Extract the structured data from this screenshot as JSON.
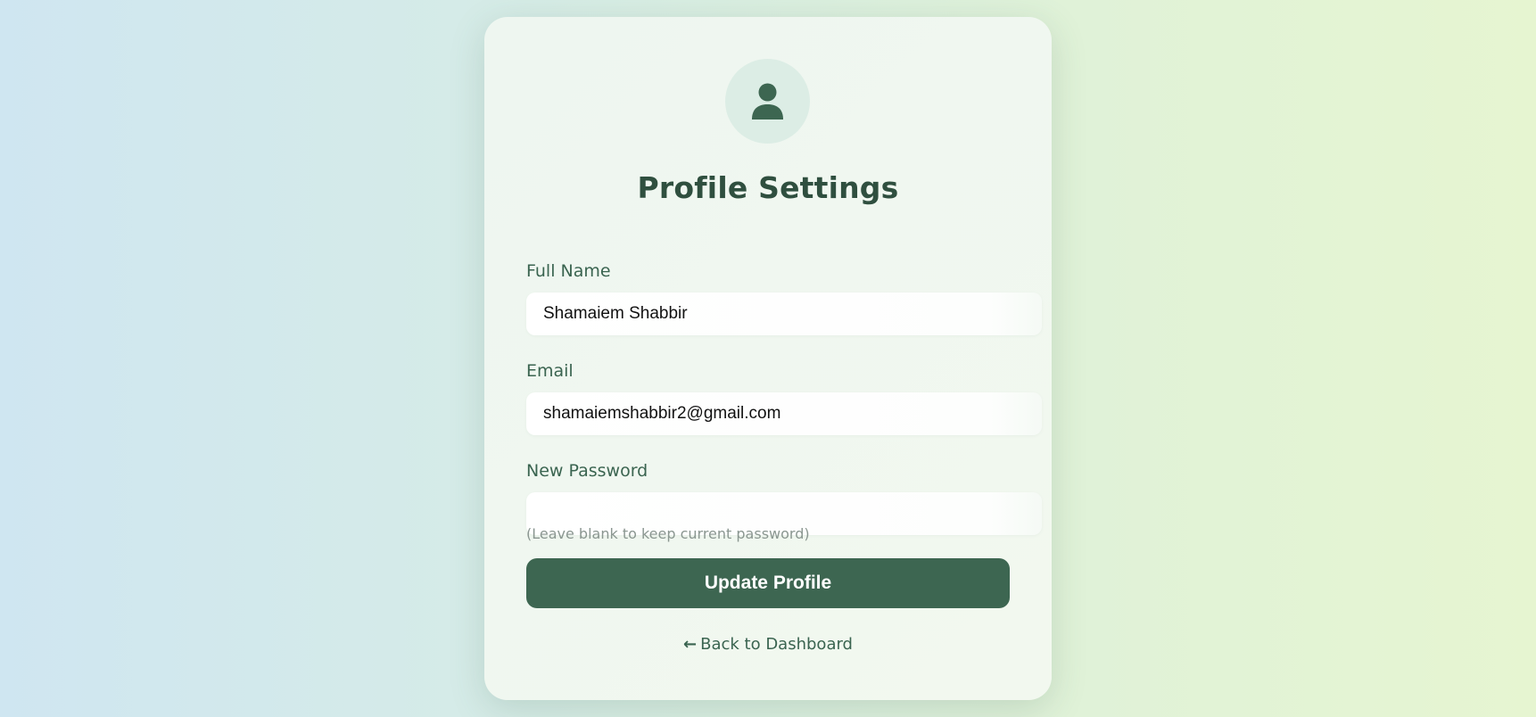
{
  "page": {
    "title": "Profile Settings",
    "avatar_icon": "user-icon"
  },
  "form": {
    "full_name": {
      "label": "Full Name",
      "value": "Shamaiem Shabbir"
    },
    "email": {
      "label": "Email",
      "value": "shamaiemshabbir2@gmail.com"
    },
    "new_password": {
      "label": "New Password",
      "value": "",
      "hint": "(Leave blank to keep current password)"
    },
    "submit_label": "Update Profile"
  },
  "nav": {
    "back_icon": "arrow-left-icon",
    "back_label": "Back to Dashboard"
  },
  "colors": {
    "accent": "#3d6651",
    "title": "#2f4f3f",
    "label": "#3a6450"
  }
}
